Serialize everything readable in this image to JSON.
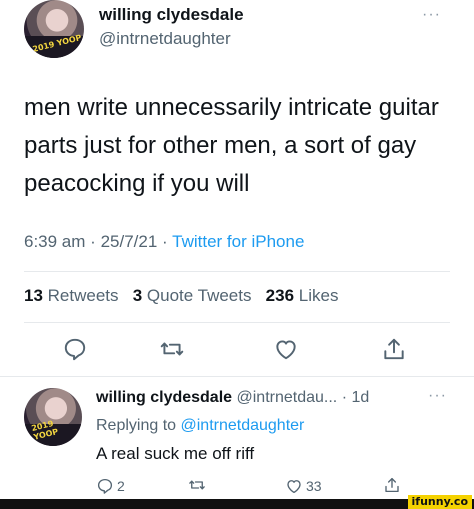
{
  "main_tweet": {
    "display_name": "willing clydesdale",
    "handle": "@intrnetdaughter",
    "more_glyph": "···",
    "avatar_shirt_text": "2019 YOOP",
    "text": "men write unnecessarily intricate guitar parts just for other men, a sort of gay peacocking if you will",
    "time": "6:39 am",
    "sep1": "·",
    "date": "25/7/21",
    "sep2": "·",
    "source": "Twitter for iPhone",
    "retweets_count": "13",
    "retweets_label": "Retweets",
    "quotes_count": "3",
    "quotes_label": "Quote Tweets",
    "likes_count": "236",
    "likes_label": "Likes",
    "actions": [
      "reply-icon",
      "retweet-icon",
      "like-icon",
      "share-icon"
    ]
  },
  "reply": {
    "display_name": "willing clydesdale",
    "handle": "@intrnetdau...",
    "time": "· 1d",
    "more_glyph": "···",
    "replying_prefix": "Replying to",
    "replying_handle": "@intrnetdaughter",
    "text": "A real suck me off riff",
    "reply_count": "2",
    "like_count": "33"
  },
  "watermark": "ifunny.co"
}
